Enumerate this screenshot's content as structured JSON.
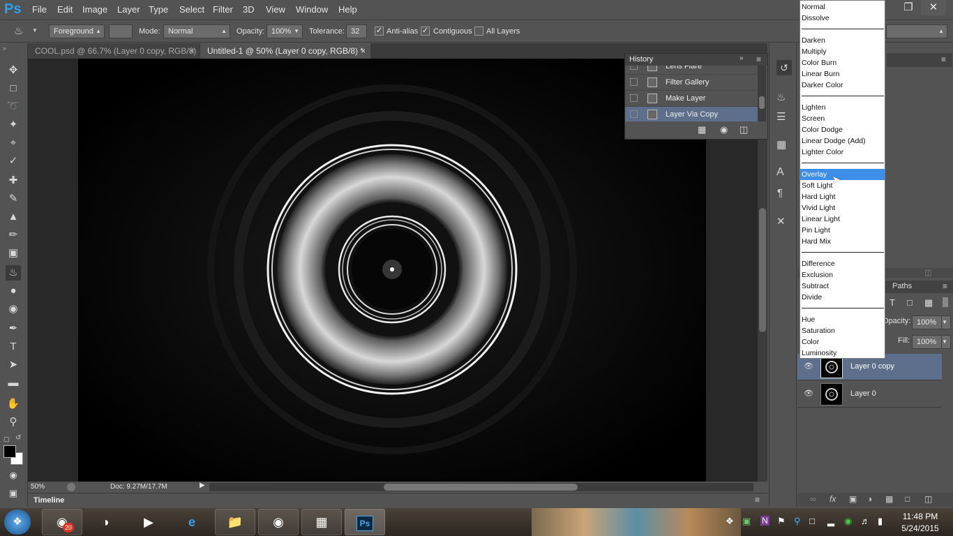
{
  "app": {
    "logo": "Ps"
  },
  "menu": [
    "File",
    "Edit",
    "Image",
    "Layer",
    "Type",
    "Select",
    "Filter",
    "3D",
    "View",
    "Window",
    "Help"
  ],
  "window_controls": {
    "minimize": "–",
    "restore": "❐",
    "close": "✕"
  },
  "options": {
    "fill_source": "Foreground",
    "mode_label": "Mode:",
    "mode_value": "Normal",
    "opacity_label": "Opacity:",
    "opacity_value": "100%",
    "tolerance_label": "Tolerance:",
    "tolerance_value": "32",
    "antialias_label": "Anti-alias",
    "antialias_checked": true,
    "contiguous_label": "Contiguous",
    "contiguous_checked": true,
    "all_layers_label": "All Layers",
    "all_layers_checked": false
  },
  "tabs": [
    {
      "label": "COOL.psd @ 66.7% (Layer 0 copy, RGB/8)",
      "active": false
    },
    {
      "label": "Untitled-1 @ 50% (Layer 0 copy, RGB/8) *",
      "active": true
    }
  ],
  "status": {
    "zoom": "50%",
    "doc": "Doc: 9.27M/17.7M"
  },
  "timeline": {
    "label": "Timeline"
  },
  "history": {
    "title": "History",
    "items": [
      {
        "label": "Lens Flare",
        "selected": false
      },
      {
        "label": "Filter Gallery",
        "selected": false
      },
      {
        "label": "Make Layer",
        "selected": false
      },
      {
        "label": "Layer Via Copy",
        "selected": true
      }
    ]
  },
  "blend_modes": {
    "groups": [
      [
        "Normal",
        "Dissolve"
      ],
      [
        "Darken",
        "Multiply",
        "Color Burn",
        "Linear Burn",
        "Darker Color"
      ],
      [
        "Lighten",
        "Screen",
        "Color Dodge",
        "Linear Dodge (Add)",
        "Lighter Color"
      ],
      [
        "Overlay",
        "Soft Light",
        "Hard Light",
        "Vivid Light",
        "Linear Light",
        "Pin Light",
        "Hard Mix"
      ],
      [
        "Difference",
        "Exclusion",
        "Subtract",
        "Divide"
      ],
      [
        "Hue",
        "Saturation",
        "Color",
        "Luminosity"
      ]
    ],
    "highlighted": "Overlay"
  },
  "layers_panel": {
    "paths_tab": "Paths",
    "opacity_label": "Opacity:",
    "opacity_value": "100%",
    "fill_label": "Fill:",
    "fill_value": "100%",
    "layers": [
      {
        "name": "Layer 0 copy",
        "selected": true
      },
      {
        "name": "Layer 0",
        "selected": false
      }
    ]
  },
  "taskbar": {
    "notification_badge": "20",
    "clock_time": "11:48 PM",
    "clock_date": "5/24/2015"
  },
  "colors": {
    "accent": "#3d8ee8",
    "ps_blue": "#2f9fe6",
    "selected_row": "#5d6f8a"
  }
}
